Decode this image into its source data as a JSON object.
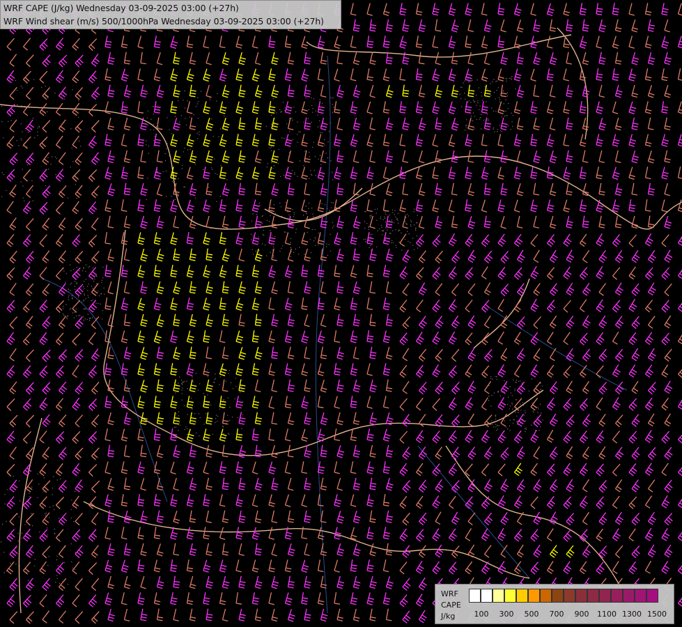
{
  "title": {
    "line1": "WRF CAPE (J/kg) Wednesday 03-09-2025 03:00 (+27h)",
    "line2": "WRF Wind shear (m/s) 500/1000hPa Wednesday 03-09-2025 03:00 (+27h)"
  },
  "legend": {
    "label_model": "WRF",
    "label_field": "CAPE",
    "label_unit": "J/kg",
    "swatch_colors": [
      "#ffffff",
      "#ffffff",
      "#ffff99",
      "#ffff33",
      "#ffcc00",
      "#ff9900",
      "#cc6600",
      "#8b4513",
      "#8b3a2b",
      "#8a2f3a",
      "#8e2a44",
      "#922550",
      "#97205c",
      "#9b1a68",
      "#a01474",
      "#a40e80"
    ],
    "tick_labels": [
      "100",
      "300",
      "500",
      "700",
      "900",
      "1100",
      "1300",
      "1500"
    ]
  },
  "colors": {
    "background": "#000000",
    "barb_weak": "#e07c6a",
    "barb_moderate": "#e8399e",
    "barb_strong": "#ff33ff",
    "barb_highcape": "#ffff00",
    "borders": "#e0b090",
    "rivers": "#3a5aa0"
  },
  "icons": {
    "wind_barb": "wind-barb-icon"
  }
}
